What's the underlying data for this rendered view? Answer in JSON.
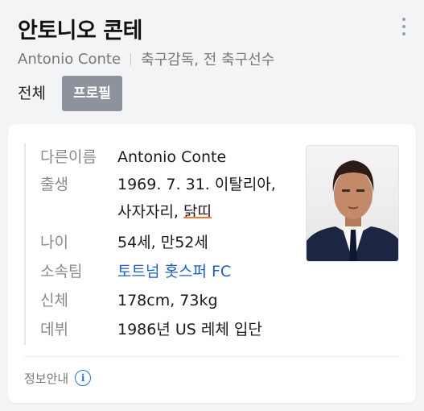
{
  "header": {
    "title": "안토니오 콘테",
    "name_en": "Antonio Conte",
    "role": "축구감독, 전 축구선수"
  },
  "icons": {
    "menu": "more-vertical-icon",
    "info": "info-icon"
  },
  "tabs": [
    {
      "label": "전체",
      "selected": false
    },
    {
      "label": "프로필",
      "selected": true
    }
  ],
  "profile": {
    "name": {
      "label": "다른이름",
      "value": "Antonio Conte"
    },
    "birth": {
      "label": "출생",
      "line1": "1969. 7. 31. 이탈리아,",
      "line2_prefix": "사자자리, ",
      "zodiac": "닭띠"
    },
    "age": {
      "label": "나이",
      "value": "54세, 만52세"
    },
    "team": {
      "label": "소속팀",
      "value": "토트넘 홋스퍼 FC"
    },
    "body": {
      "label": "신체",
      "value": "178cm, 73kg"
    },
    "debut": {
      "label": "데뷔",
      "value": "1986년 US 레체 입단"
    }
  },
  "footer": {
    "info_label": "정보안내",
    "info_symbol": "i"
  },
  "colors": {
    "accent_link": "#1d5dc4",
    "tab_active_bg": "#8c939c",
    "highlight_underline": "#f07a3a"
  }
}
